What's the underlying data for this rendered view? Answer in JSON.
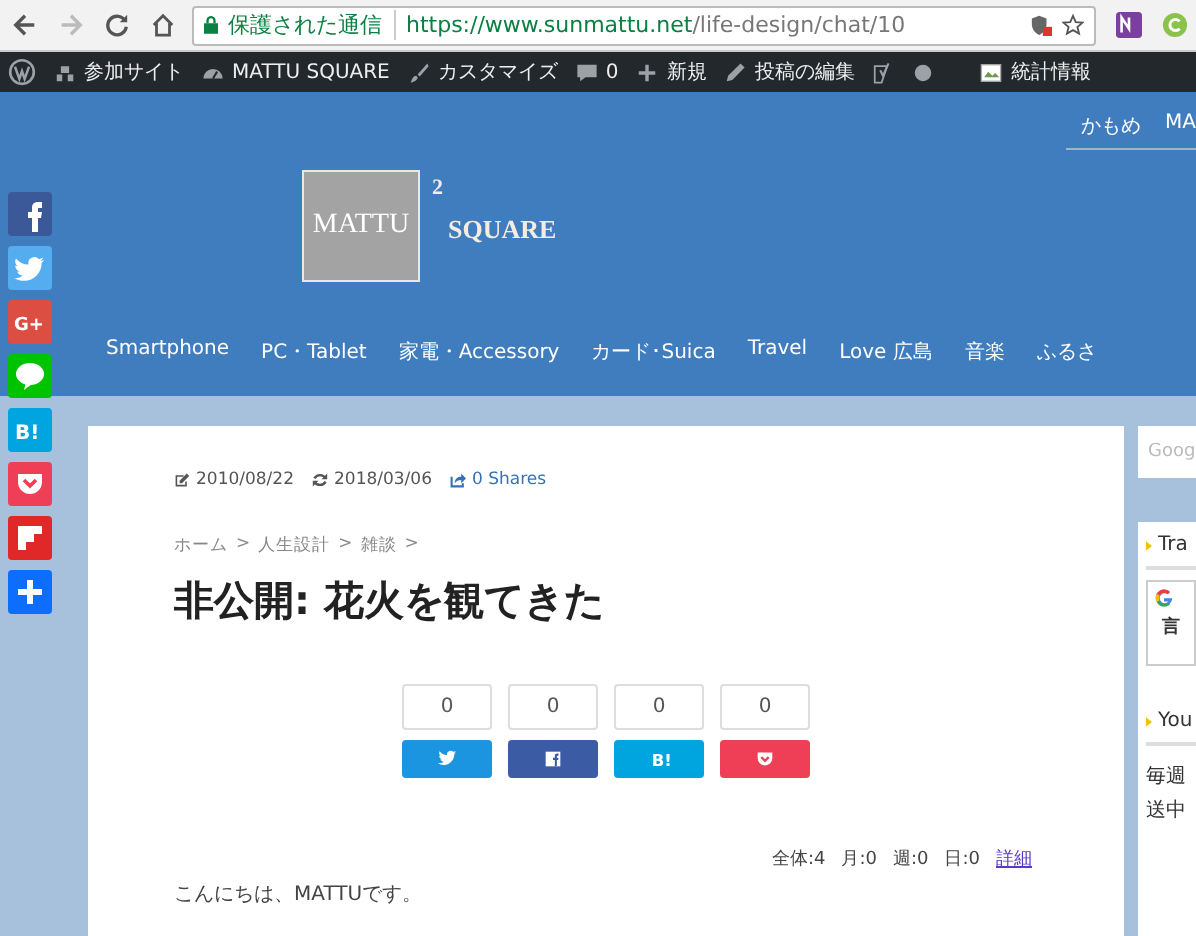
{
  "browser": {
    "secure_label": "保護された通信",
    "url_host": "https://www.sunmattu.net",
    "url_path": "/life-design/chat/10"
  },
  "admin_bar": [
    {
      "kind": "wp"
    },
    {
      "kind": "sites",
      "label": "参加サイト"
    },
    {
      "kind": "dashboard",
      "label": "MATTU SQUARE"
    },
    {
      "kind": "brush",
      "label": "カスタマイズ"
    },
    {
      "kind": "comments",
      "label": "0"
    },
    {
      "kind": "plus",
      "label": "新規"
    },
    {
      "kind": "pencil",
      "label": "投稿の編集"
    },
    {
      "kind": "yoast"
    },
    {
      "kind": "dot"
    },
    {
      "kind": "image",
      "label": "統計情報"
    }
  ],
  "header": {
    "top_menu": [
      "かもめ",
      "MA"
    ],
    "logo": {
      "box_text": "MATTU",
      "superscript": "2",
      "name": "SQUARE"
    },
    "nav": [
      "Smartphone",
      "PC・Tablet",
      "家電・Accessory",
      "カード･Suica",
      "Travel",
      "Love 広島",
      "音楽",
      "ふるさ"
    ]
  },
  "share_sidebar": [
    {
      "kind": "facebook"
    },
    {
      "kind": "twitter"
    },
    {
      "kind": "googleplus",
      "label": "G+"
    },
    {
      "kind": "line"
    },
    {
      "kind": "hatena",
      "label": "B!"
    },
    {
      "kind": "pocket"
    },
    {
      "kind": "flipboard"
    },
    {
      "kind": "plus"
    }
  ],
  "article": {
    "posted": "2010/08/22",
    "updated": "2018/03/06",
    "shares": "0 Shares",
    "breadcrumb": [
      "ホーム",
      "人生設計",
      "雑談"
    ],
    "breadcrumb_separator": ">",
    "title": "非公開: 花火を観てきた",
    "share_buttons": [
      {
        "kind": "twitter",
        "count": "0"
      },
      {
        "kind": "facebook",
        "count": "0"
      },
      {
        "kind": "hatena",
        "count": "0",
        "label": "B!"
      },
      {
        "kind": "pocket",
        "count": "0"
      }
    ],
    "stats": [
      "全体:4",
      "月:0",
      "週:0",
      "日:0"
    ],
    "stats_link": "詳細",
    "body": "こんにちは、MATTUです。"
  },
  "sidebar": {
    "search_placeholder": "Goog",
    "widgets": [
      {
        "kind": "translate",
        "title": "Tra",
        "lines": [
          "言"
        ]
      },
      {
        "kind": "text",
        "title": "You",
        "lines": [
          "毎週",
          "送中"
        ]
      }
    ]
  }
}
